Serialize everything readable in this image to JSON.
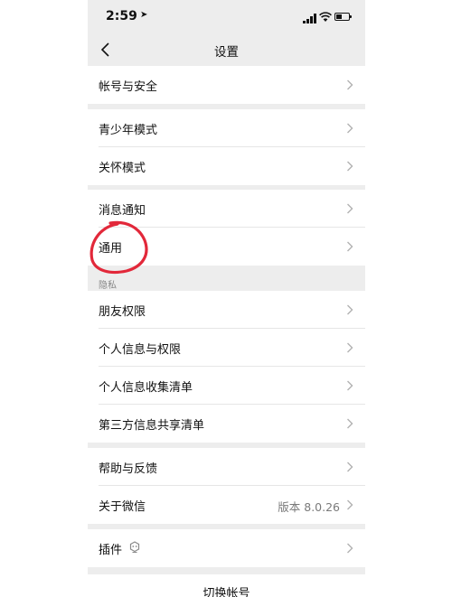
{
  "status_bar": {
    "time": "2:59"
  },
  "nav": {
    "title": "设置"
  },
  "groups": [
    {
      "items": [
        {
          "label": "帐号与安全"
        }
      ]
    },
    {
      "items": [
        {
          "label": "青少年模式"
        },
        {
          "label": "关怀模式"
        }
      ]
    },
    {
      "items": [
        {
          "label": "消息通知"
        },
        {
          "label": "通用"
        }
      ]
    },
    {
      "section_label": "隐私",
      "items": [
        {
          "label": "朋友权限"
        },
        {
          "label": "个人信息与权限"
        },
        {
          "label": "个人信息收集清单"
        },
        {
          "label": "第三方信息共享清单"
        }
      ]
    },
    {
      "items": [
        {
          "label": "帮助与反馈"
        },
        {
          "label": "关于微信",
          "value": "版本 8.0.26"
        }
      ]
    },
    {
      "items": [
        {
          "label": "插件",
          "icon": "plugin-icon"
        }
      ]
    }
  ],
  "footer": {
    "switch_account": "切换帐号"
  },
  "colors": {
    "page_bg": "#ededed",
    "cell_bg": "#ffffff",
    "annotation": "#e2283a"
  }
}
